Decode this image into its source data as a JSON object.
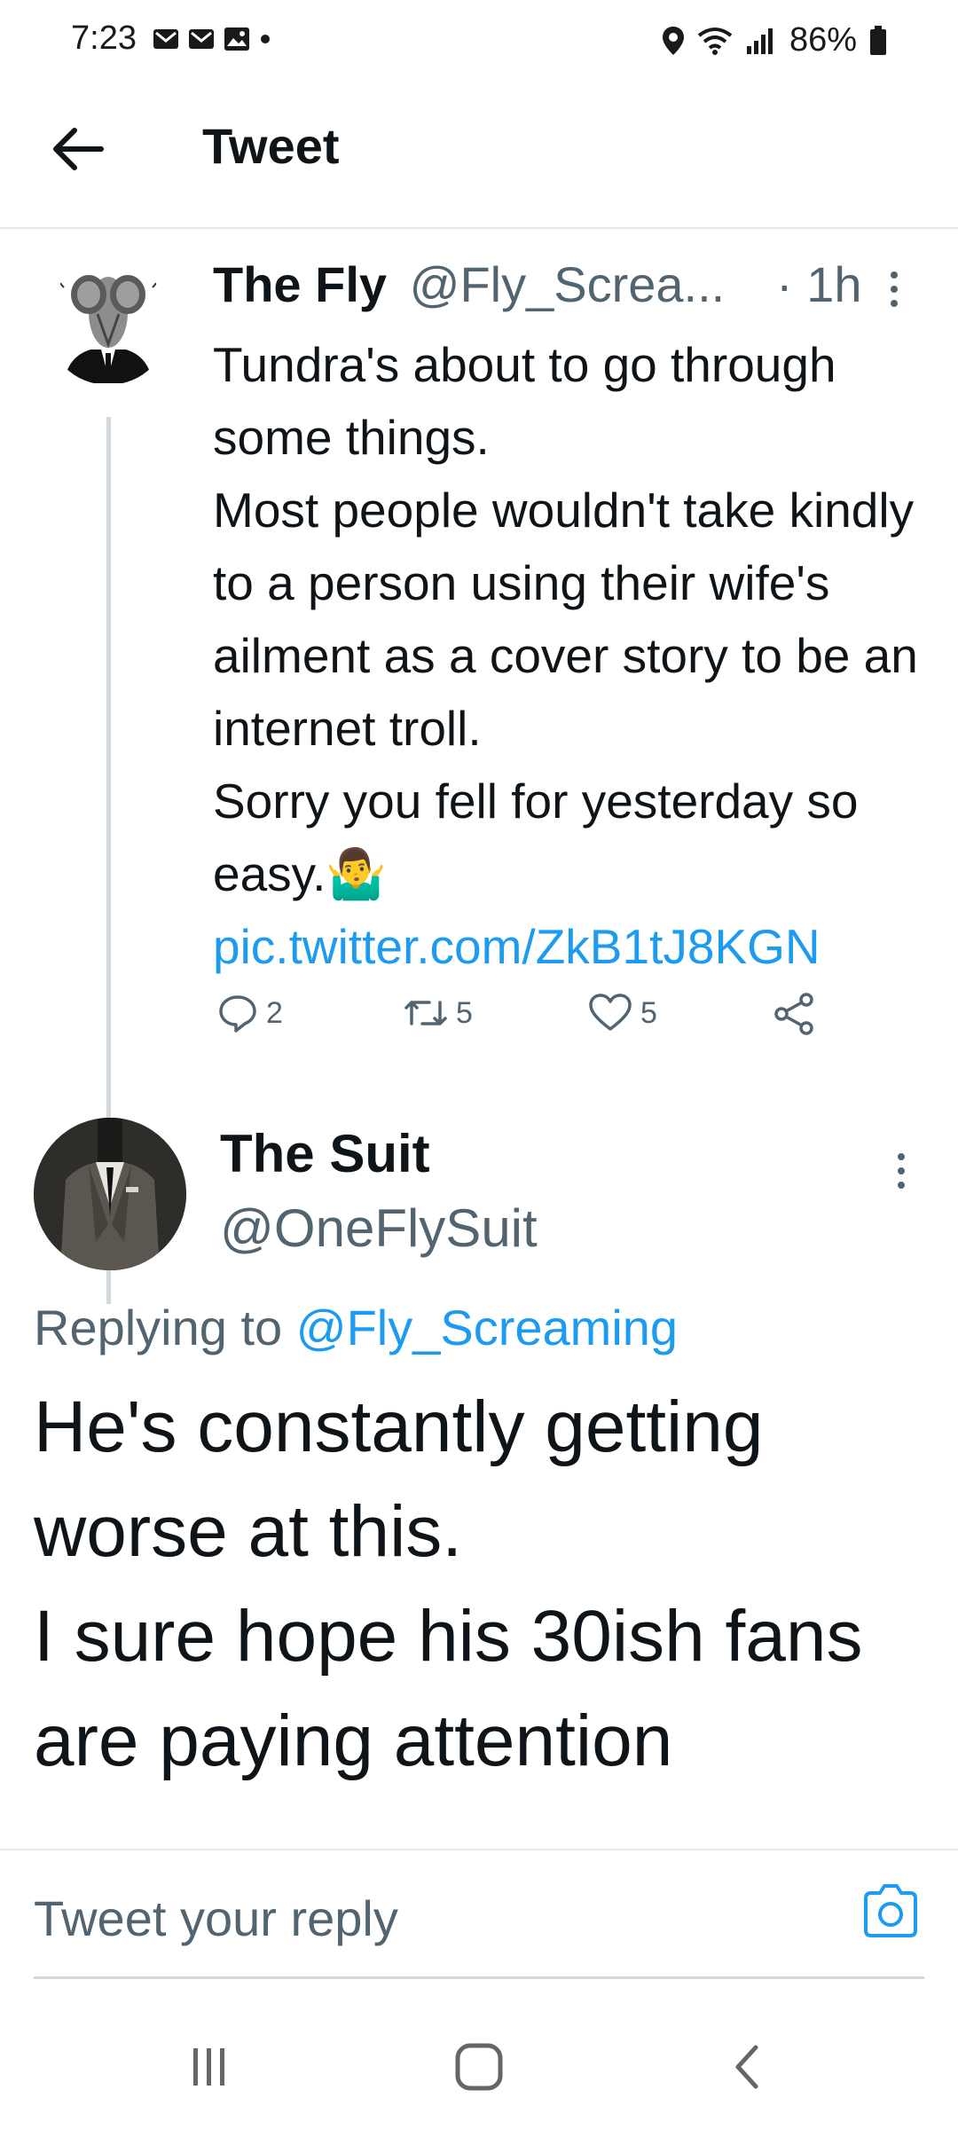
{
  "status_bar": {
    "time": "7:23",
    "battery": "86%"
  },
  "header": {
    "title": "Tweet"
  },
  "tweet": {
    "name": "The Fly",
    "handle": "@Fly_Screa...",
    "time": "· 1h",
    "body_lines": [
      "Tundra's about to go through some things.",
      "Most people wouldn't take kindly to a person using their wife's ailment as a cover story to be an internet troll.",
      "Sorry you fell for yesterday so easy."
    ],
    "emoji": "🤷‍♂️",
    "link": "pic.twitter.com/ZkB1tJ8KGN",
    "replies": "2",
    "retweets": "5",
    "likes": "5"
  },
  "reply": {
    "name": "The Suit",
    "handle": "@OneFlySuit",
    "replying_prefix": "Replying to ",
    "replying_to": "@Fly_Screaming",
    "body_lines": [
      "He's constantly getting worse at this.",
      "I sure hope his 30ish fans are paying attention"
    ]
  },
  "reply_bar": {
    "placeholder": "Tweet your reply"
  },
  "colors": {
    "accent": "#1d9bf0",
    "secondary_text": "#536471",
    "primary_text": "#0f1419"
  }
}
